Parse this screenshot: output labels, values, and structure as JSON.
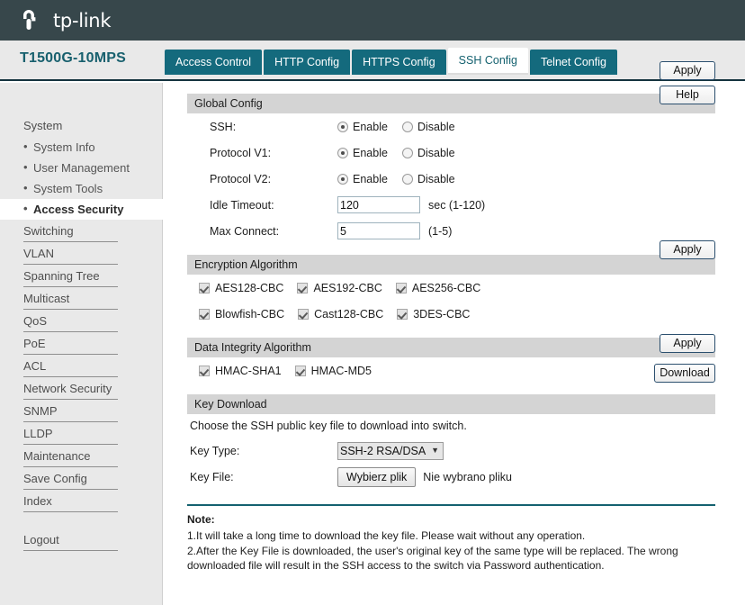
{
  "header": {
    "brand": "tp-link",
    "logo_icon": "tplink-logo-icon",
    "model": "T1500G-10MPS"
  },
  "tabs": [
    {
      "label": "Access Control",
      "active": false
    },
    {
      "label": "HTTP Config",
      "active": false
    },
    {
      "label": "HTTPS Config",
      "active": false
    },
    {
      "label": "SSH Config",
      "active": true
    },
    {
      "label": "Telnet Config",
      "active": false
    }
  ],
  "sidebar": {
    "group_title": "System",
    "sub_items": [
      {
        "label": "System Info",
        "active": false
      },
      {
        "label": "User Management",
        "active": false
      },
      {
        "label": "System Tools",
        "active": false
      },
      {
        "label": "Access Security",
        "active": true
      }
    ],
    "items": [
      "Switching",
      "VLAN",
      "Spanning Tree",
      "Multicast",
      "QoS",
      "PoE",
      "ACL",
      "Network Security",
      "SNMP",
      "LLDP",
      "Maintenance",
      "Save Config",
      "Index"
    ],
    "logout": "Logout"
  },
  "global_config": {
    "title": "Global Config",
    "rows": [
      {
        "label": "SSH:",
        "enable": "Enable",
        "disable": "Disable",
        "selected": "Enable"
      },
      {
        "label": "Protocol V1:",
        "enable": "Enable",
        "disable": "Disable",
        "selected": "Enable"
      },
      {
        "label": "Protocol V2:",
        "enable": "Enable",
        "disable": "Disable",
        "selected": "Enable"
      }
    ],
    "idle_timeout": {
      "label": "Idle Timeout:",
      "value": "120",
      "hint": "sec (1-120)"
    },
    "max_connect": {
      "label": "Max Connect:",
      "value": "5",
      "hint": "(1-5)"
    },
    "apply_label": "Apply",
    "help_label": "Help"
  },
  "encryption": {
    "title": "Encryption Algorithm",
    "row1": [
      {
        "label": "AES128-CBC",
        "checked": true
      },
      {
        "label": "AES192-CBC",
        "checked": true
      },
      {
        "label": "AES256-CBC",
        "checked": true
      }
    ],
    "row2": [
      {
        "label": "Blowfish-CBC",
        "checked": true
      },
      {
        "label": "Cast128-CBC",
        "checked": true
      },
      {
        "label": "3DES-CBC",
        "checked": true
      }
    ],
    "apply_label": "Apply"
  },
  "integrity": {
    "title": "Data Integrity Algorithm",
    "items": [
      {
        "label": "HMAC-SHA1",
        "checked": true
      },
      {
        "label": "HMAC-MD5",
        "checked": true
      }
    ],
    "apply_label": "Apply"
  },
  "key_download": {
    "title": "Key Download",
    "instruction": "Choose the SSH public key file to download into switch.",
    "key_type_label": "Key Type:",
    "key_type_value": "SSH-2 RSA/DSA",
    "key_type_options": [
      "SSH-2 RSA/DSA"
    ],
    "key_file_label": "Key File:",
    "file_button": "Wybierz plik",
    "file_status": "Nie wybrano pliku",
    "download_label": "Download"
  },
  "note": {
    "title": "Note:",
    "line1": "1.It will take a long time to download the key file. Please wait without any operation.",
    "line2": "2.After the Key File is downloaded, the user's original key of the same type will be replaced. The wrong downloaded file will result in the SSH access to the switch via Password authentication."
  },
  "colors": {
    "topbar": "#37474b",
    "tab_active_text": "#14616f",
    "tab_bg": "#146a7d",
    "model_text": "#18606e",
    "section_bar": "#d4d4d4",
    "sidebar_bg": "#e9e9e9"
  }
}
